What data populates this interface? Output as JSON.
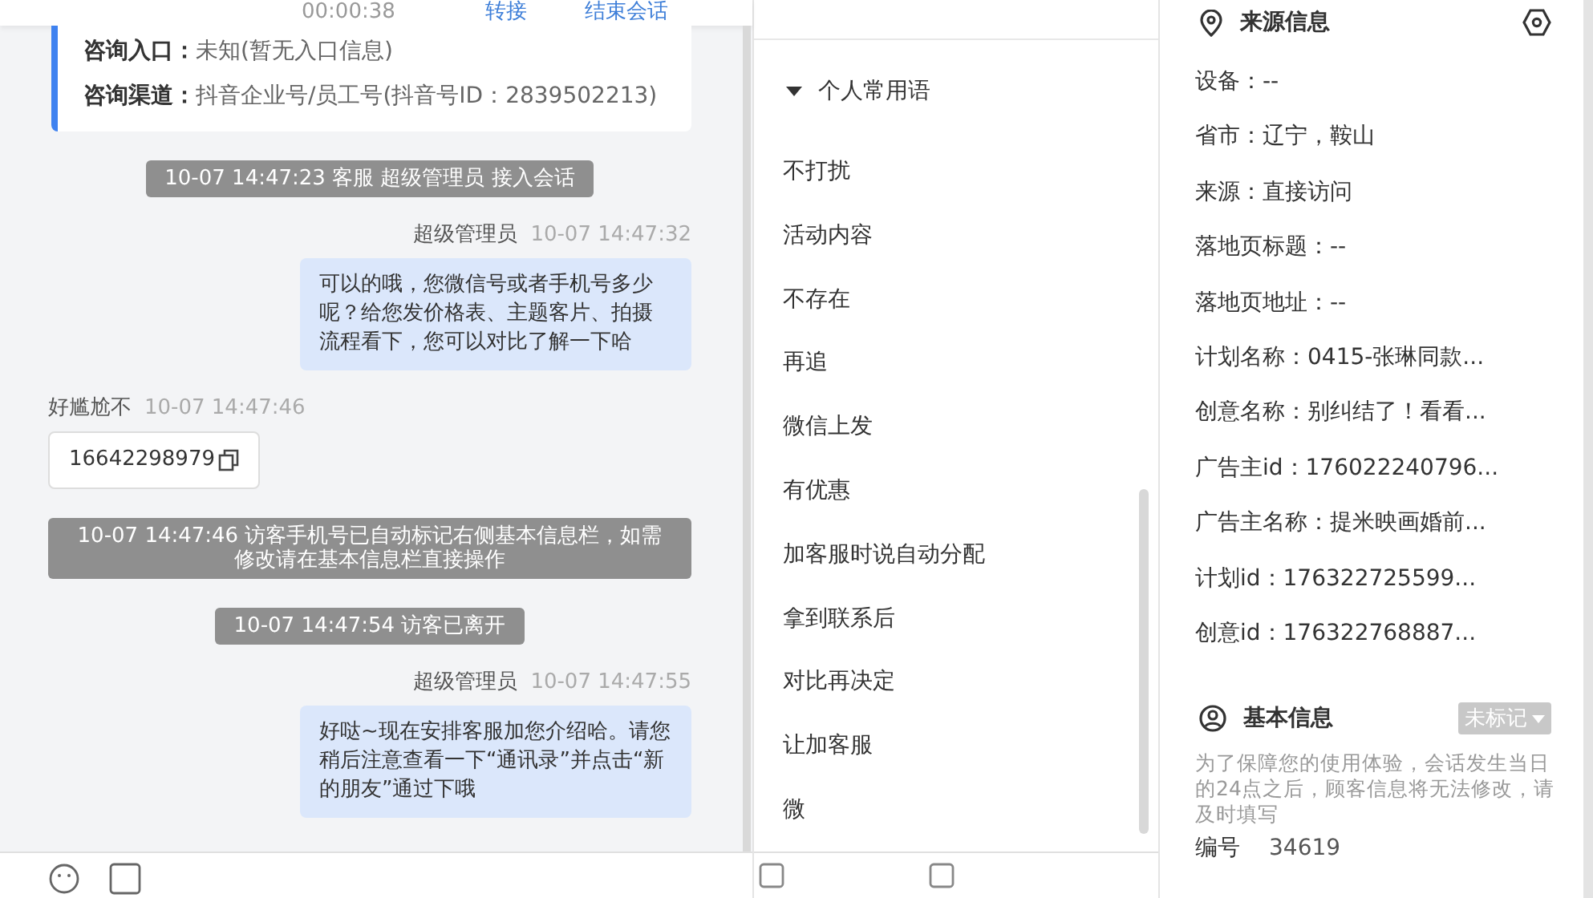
{
  "top_bar": {
    "timer": "00:00:38",
    "actions": [
      "转接",
      "结束会话"
    ]
  },
  "chat": {
    "entry_card": [
      {
        "label": "咨询入口：",
        "value": "未知(暂无入口信息)"
      },
      {
        "label": "咨询渠道：",
        "value": "抖音企业号/员工号(抖音号ID：2839502213)"
      }
    ],
    "messages": [
      {
        "kind": "system",
        "text": "10-07 14:47:23 客服 超级管理员 接入会话"
      },
      {
        "kind": "agent",
        "sender": "超级管理员",
        "time": "10-07 14:47:32",
        "text": "可以的哦，您微信号或者手机号多少呢？给您发价格表、主题客片、拍摄流程看下，您可以对比了解一下哈"
      },
      {
        "kind": "visitor",
        "sender": "好尴尬不",
        "time": "10-07 14:47:46",
        "text": "16642298979"
      },
      {
        "kind": "system",
        "text": "10-07 14:47:46 访客手机号已自动标记右侧基本信息栏，如需修改请在基本信息栏直接操作"
      },
      {
        "kind": "system",
        "text": "10-07 14:47:54 访客已离开"
      },
      {
        "kind": "agent",
        "sender": "超级管理员",
        "time": "10-07 14:47:55",
        "text": "好哒~现在安排客服加您介绍哈。请您稍后注意查看一下“通讯录”并点击“新的朋友”通过下哦"
      }
    ]
  },
  "phrases": {
    "group": {
      "title": "个人常用语",
      "expanded": true
    },
    "items": [
      "不打扰",
      "活动内容",
      "不存在",
      "再追",
      "微信上发",
      "有优惠",
      "加客服时说自动分配",
      "拿到联系后",
      "对比再决定",
      "让加客服",
      "微"
    ]
  },
  "source_info": {
    "title": "来源信息",
    "rows": [
      "设备：--",
      "省市：辽宁，鞍山",
      "来源：直接访问",
      "落地页标题：--",
      "落地页地址：--",
      "计划名称：0415-张琳同款...",
      "创意名称：别纠结了！看看...",
      "广告主id：176022240796...",
      "广告主名称：提米映画婚前...",
      "计划id：176322725599...",
      "创意id：176322768887..."
    ]
  },
  "basic_info": {
    "title": "基本信息",
    "tag": "未标记",
    "note": "为了保障您的使用体验，会话发生当日的24点之后，顾客信息将无法修改，请及时填写",
    "rows": [
      {
        "label": "编号",
        "value": "34619"
      }
    ]
  }
}
